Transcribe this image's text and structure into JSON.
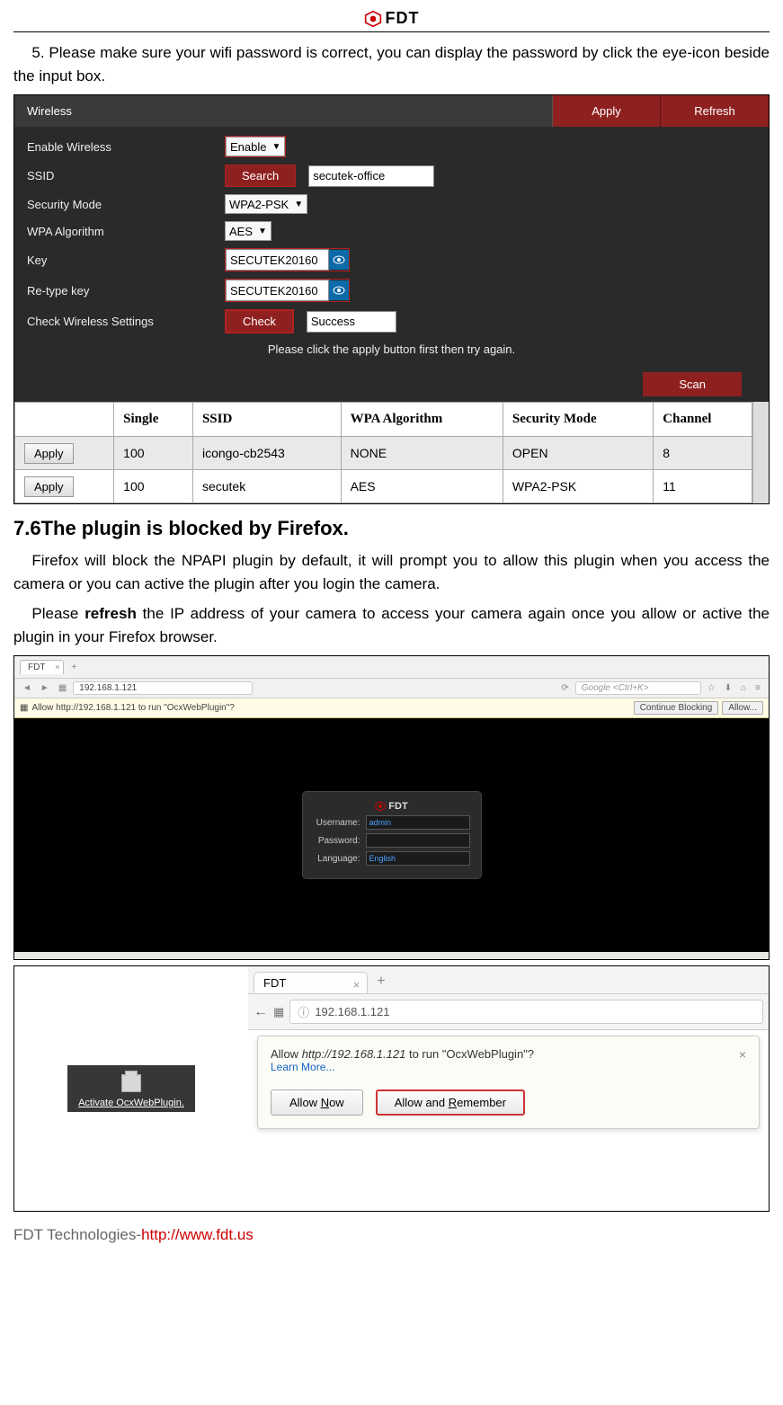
{
  "logo_text": "FDT",
  "intro_text": "5. Please make sure your wifi password is correct, you can display the password by click the eye-icon beside the input box.",
  "wireless": {
    "title": "Wireless",
    "apply_btn": "Apply",
    "refresh_btn": "Refresh",
    "labels": {
      "enable": "Enable Wireless",
      "ssid": "SSID",
      "security": "Security Mode",
      "wpa": "WPA Algorithm",
      "key": "Key",
      "retype": "Re-type key",
      "check_settings": "Check Wireless Settings"
    },
    "values": {
      "enable_sel": "Enable",
      "search_btn": "Search",
      "ssid_val": "secutek-office",
      "security_sel": "WPA2-PSK",
      "wpa_sel": "AES",
      "key_val": "SECUTEK20160",
      "retype_val": "SECUTEK20160",
      "check_btn": "Check",
      "check_status": "Success"
    },
    "hint": "Please click the apply button first then try again.",
    "scan_btn": "Scan",
    "table": {
      "headers": [
        "",
        "Single",
        "SSID",
        "WPA Algorithm",
        "Security Mode",
        "Channel"
      ],
      "apply_label": "Apply",
      "rows": [
        {
          "single": "100",
          "ssid": "icongo-cb2543",
          "wpa": "NONE",
          "sec": "OPEN",
          "ch": "8"
        },
        {
          "single": "100",
          "ssid": "secutek",
          "wpa": "AES",
          "sec": "WPA2-PSK",
          "ch": "11"
        }
      ]
    }
  },
  "section_heading": "7.6The plugin is blocked by Firefox.",
  "para1_a": "Firefox will block the NPAPI plugin by default, it will prompt you to allow this plugin when you access the camera or you can active the plugin after you login the camera.",
  "para2_prefix": "Please ",
  "para2_bold": "refresh",
  "para2_suffix": " the IP address of your camera to access your camera again once you allow or active the plugin in your Firefox browser.",
  "ff1": {
    "tab": "FDT",
    "url": "192.168.1.121",
    "search_ph": "Google <Ctrl+K>",
    "yellow_msg": "Allow http://192.168.1.121 to run \"OcxWebPlugin\"?",
    "continue_btn": "Continue Blocking",
    "allow_btn": "Allow...",
    "login": {
      "brand": "FDT",
      "user_l": "Username:",
      "user_v": "admin",
      "pass_l": "Password:",
      "lang_l": "Language:",
      "lang_v": "English"
    }
  },
  "activate_label": "Activate OcxWebPlugin.",
  "ff2": {
    "tab": "FDT",
    "url": "192.168.1.121",
    "popup_msg_a": "Allow ",
    "popup_msg_i": "http://192.168.1.121",
    "popup_msg_b": " to run \"OcxWebPlugin\"?",
    "learn": "Learn More...",
    "allow_now": "Allow Now",
    "allow_remember": "Allow and Remember"
  },
  "footer_gray": "FDT Technologies-",
  "footer_link": "http://www.fdt.us"
}
